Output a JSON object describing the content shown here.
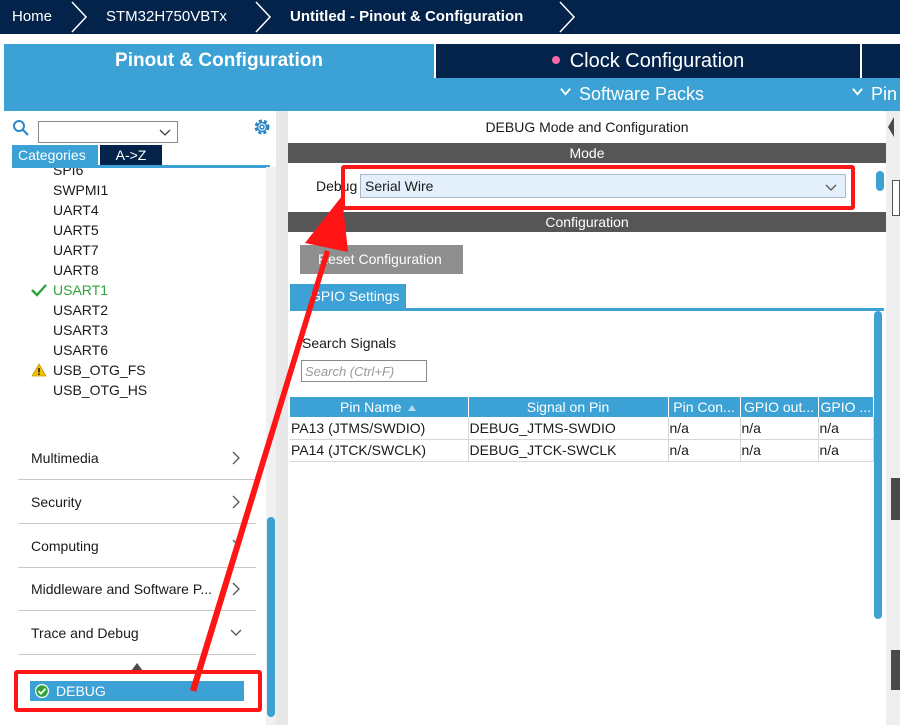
{
  "breadcrumb": {
    "items": [
      "Home",
      "STM32H750VBTx",
      "Untitled - Pinout & Configuration"
    ]
  },
  "top_tabs": {
    "pinout": "Pinout & Configuration",
    "clock": "Clock Configuration"
  },
  "sub_bar": {
    "software_packs": "Software Packs",
    "pinout_partial": "Pin"
  },
  "left_panel": {
    "category_tab": "Categories",
    "az_tab": "A->Z",
    "peripherals": [
      {
        "label": "SPI6",
        "status": "none"
      },
      {
        "label": "SWPMI1",
        "status": "none"
      },
      {
        "label": "UART4",
        "status": "none"
      },
      {
        "label": "UART5",
        "status": "none"
      },
      {
        "label": "UART7",
        "status": "none"
      },
      {
        "label": "UART8",
        "status": "none"
      },
      {
        "label": "USART1",
        "status": "configured"
      },
      {
        "label": "USART2",
        "status": "none"
      },
      {
        "label": "USART3",
        "status": "none"
      },
      {
        "label": "USART6",
        "status": "none"
      },
      {
        "label": "USB_OTG_FS",
        "status": "warning"
      },
      {
        "label": "USB_OTG_HS",
        "status": "none"
      }
    ],
    "sections": [
      {
        "label": "Multimedia",
        "expanded": false
      },
      {
        "label": "Security",
        "expanded": false
      },
      {
        "label": "Computing",
        "expanded": false
      },
      {
        "label": "Middleware and Software P...",
        "expanded": false
      },
      {
        "label": "Trace and Debug",
        "expanded": true
      }
    ],
    "selected_item": "DEBUG"
  },
  "right_panel": {
    "title": "DEBUG Mode and Configuration",
    "mode_header": "Mode",
    "debug_label": "Debug",
    "debug_value": "Serial Wire",
    "config_header": "Configuration",
    "reset_button": "Reset Configuration",
    "gpio_tab": "GPIO Settings",
    "search_label": "Search Signals",
    "search_placeholder": "Search (Ctrl+F)",
    "table": {
      "columns": [
        "Pin Name",
        "Signal on Pin",
        "Pin Con...",
        "GPIO out...",
        "GPIO ..."
      ],
      "rows": [
        [
          "PA13 (JTMS/SWDIO)",
          "DEBUG_JTMS-SWDIO",
          "n/a",
          "n/a",
          "n/a"
        ],
        [
          "PA14 (JTCK/SWCLK)",
          "DEBUG_JTCK-SWCLK",
          "n/a",
          "n/a",
          "n/a"
        ]
      ]
    }
  },
  "colors": {
    "navy": "#03234b",
    "accent_blue": "#3ca1d4",
    "header_gray": "#565656",
    "annotation_red": "#ff1515",
    "ok_green": "#2fa33a",
    "warning_yellow": "#f3c000"
  },
  "icons": [
    "search-icon",
    "gear-icon",
    "checkmark-icon",
    "warning-icon",
    "chevron-right-icon",
    "chevron-down-icon",
    "check-circle-icon",
    "sort-arrow-icon"
  ]
}
